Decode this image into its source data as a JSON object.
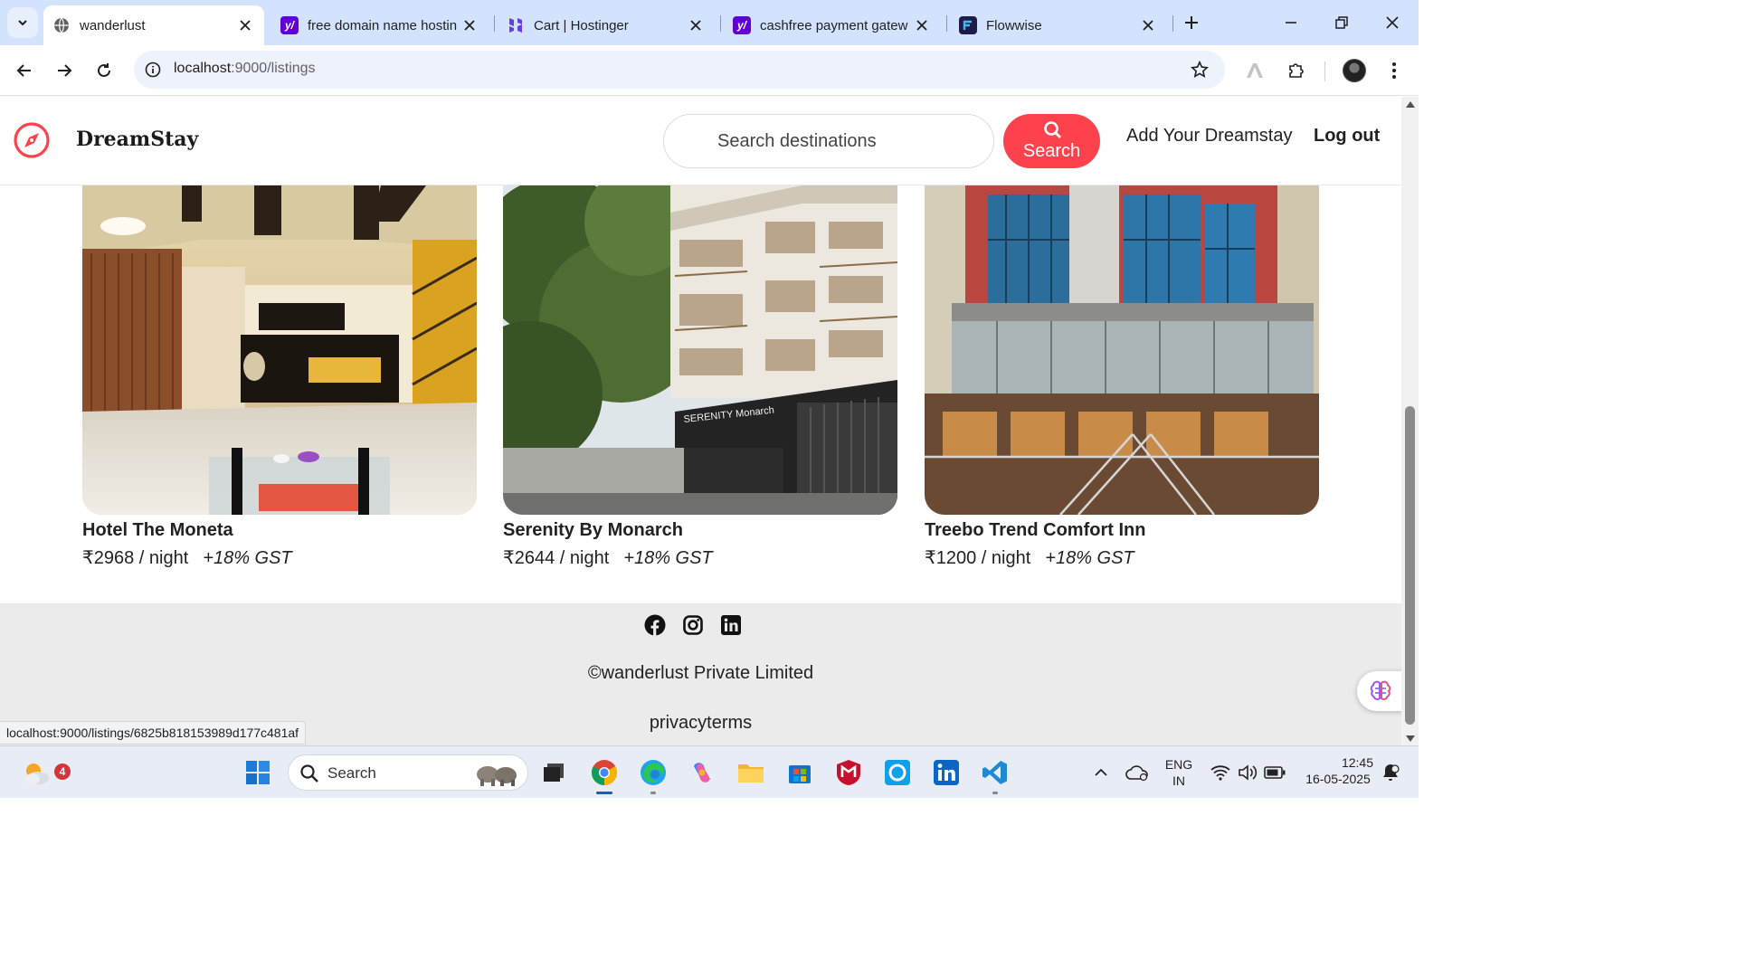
{
  "browser": {
    "tabs": [
      {
        "title": "wanderlust",
        "active": true
      },
      {
        "title": "free domain name hostin",
        "active": false
      },
      {
        "title": "Cart | Hostinger",
        "active": false
      },
      {
        "title": "cashfree payment gatew",
        "active": false
      },
      {
        "title": "Flowwise",
        "active": false
      }
    ],
    "url_host": "localhost",
    "url_path": ":9000/listings",
    "status_url": "localhost:9000/listings/6825b818153989d177c481af"
  },
  "site": {
    "brand": "DreamStay",
    "search_placeholder": "Search destinations",
    "search_button": "Search",
    "nav_add": "Add Your Dreamstay",
    "nav_logout": "Log out",
    "listings": [
      {
        "title": "Hotel The Moneta",
        "price": "₹2968 / night",
        "gst": "+18% GST"
      },
      {
        "title": "Serenity By Monarch",
        "price": "₹2644 / night",
        "gst": "+18% GST",
        "sign": "SERENITY Monarch"
      },
      {
        "title": "Treebo Trend Comfort Inn",
        "price": "₹1200 / night",
        "gst": "+18% GST"
      }
    ],
    "footer": {
      "copyright": "©wanderlust Private Limited",
      "links": [
        "privacy",
        "terms"
      ]
    },
    "accent_color": "#fe424d"
  },
  "taskbar": {
    "weather_badge": "4",
    "search_label": "Search",
    "language_line1": "ENG",
    "language_line2": "IN",
    "time": "12:45",
    "date": "16-05-2025"
  }
}
